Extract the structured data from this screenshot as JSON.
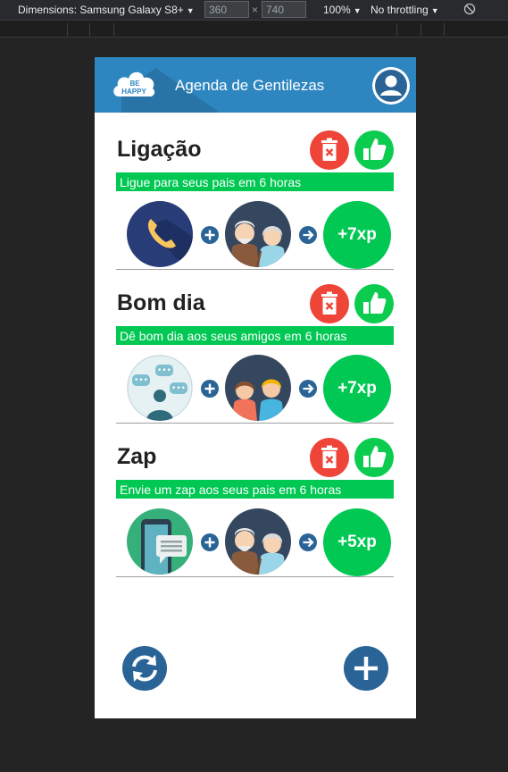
{
  "devtools": {
    "device_label": "Dimensions: Samsung Galaxy S8+",
    "width": "360",
    "times": "×",
    "height": "740",
    "zoom": "100%",
    "throttling": "No throttling"
  },
  "app": {
    "logo_line1": "BE",
    "logo_line2": "HAPPY",
    "title": "Agenda de Gentilezas"
  },
  "colors": {
    "header": "#2e86c1",
    "green": "#00c853",
    "red": "#ef4438",
    "dark_blue": "#2a6496"
  },
  "tasks": [
    {
      "title": "Ligação",
      "description": "Ligue para seus pais em 6 horas",
      "action_icon": "phone-icon",
      "target_icon": "elderly-parents-icon",
      "xp": "+7xp"
    },
    {
      "title": "Bom dia",
      "description": "Dê bom dia aos seus amigos em 6 horas",
      "action_icon": "chat-bubbles-icon",
      "target_icon": "friends-icon",
      "xp": "+7xp"
    },
    {
      "title": "Zap",
      "description": "Envie um zap aos seus pais em 6 horas",
      "action_icon": "smartphone-message-icon",
      "target_icon": "elderly-parents-icon",
      "xp": "+5xp"
    }
  ]
}
